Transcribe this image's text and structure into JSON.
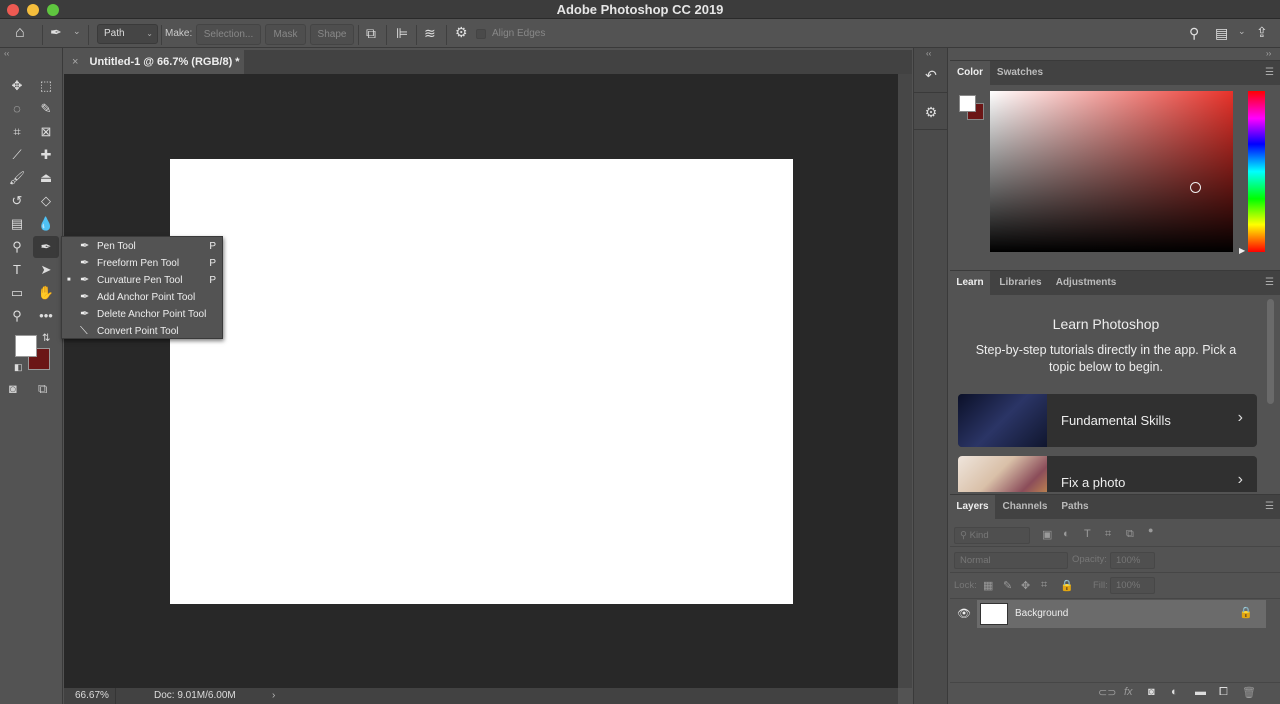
{
  "window": {
    "title": "Adobe Photoshop CC 2019"
  },
  "options_bar": {
    "mode": "Path",
    "make_label": "Make:",
    "selection_btn": "Selection...",
    "mask_btn": "Mask",
    "shape_btn": "Shape",
    "align_edges_label": "Align Edges",
    "align_edges_checked": false
  },
  "document": {
    "tab_title": "Untitled-1 @ 66.7% (RGB/8) *",
    "zoom": "66.67%",
    "doc_info": "Doc: 9.01M/6.00M"
  },
  "toolbar": {
    "tools": [
      {
        "name": "move-tool",
        "glyph": "✥"
      },
      {
        "name": "marquee-tool",
        "glyph": "⬚"
      },
      {
        "name": "lasso-tool",
        "glyph": "◌"
      },
      {
        "name": "quick-selection-tool",
        "glyph": "✎"
      },
      {
        "name": "crop-tool",
        "glyph": "⌗"
      },
      {
        "name": "frame-tool",
        "glyph": "⊠"
      },
      {
        "name": "eyedropper-tool",
        "glyph": "⟋"
      },
      {
        "name": "healing-brush-tool",
        "glyph": "✚"
      },
      {
        "name": "brush-tool",
        "glyph": "🖌"
      },
      {
        "name": "clone-stamp-tool",
        "glyph": "⏏"
      },
      {
        "name": "history-brush-tool",
        "glyph": "↺"
      },
      {
        "name": "eraser-tool",
        "glyph": "◇"
      },
      {
        "name": "gradient-tool",
        "glyph": "▤"
      },
      {
        "name": "blur-tool",
        "glyph": "💧"
      },
      {
        "name": "dodge-tool",
        "glyph": "⚲"
      },
      {
        "name": "pen-tool",
        "glyph": "✒"
      },
      {
        "name": "type-tool",
        "glyph": "T"
      },
      {
        "name": "path-selection-tool",
        "glyph": "➤"
      },
      {
        "name": "rectangle-tool",
        "glyph": "▭"
      },
      {
        "name": "hand-tool",
        "glyph": "✋"
      },
      {
        "name": "zoom-tool",
        "glyph": "⚲"
      },
      {
        "name": "more-tools",
        "glyph": "•••"
      }
    ],
    "foreground_color": "#ffffff",
    "background_color": "#6b1616"
  },
  "pen_flyout": {
    "items": [
      {
        "label": "Pen Tool",
        "shortcut": "P",
        "selected": false
      },
      {
        "label": "Freeform Pen Tool",
        "shortcut": "P",
        "selected": false
      },
      {
        "label": "Curvature Pen Tool",
        "shortcut": "P",
        "selected": true
      },
      {
        "label": "Add Anchor Point Tool",
        "shortcut": "",
        "selected": false
      },
      {
        "label": "Delete Anchor Point Tool",
        "shortcut": "",
        "selected": false
      },
      {
        "label": "Convert Point Tool",
        "shortcut": "",
        "selected": false
      }
    ]
  },
  "color_panel": {
    "tabs": [
      "Color",
      "Swatches"
    ],
    "active_tab": "Color",
    "hue_color": "#e8322a",
    "foreground": "#ffffff",
    "background": "#6b1616"
  },
  "learn_panel": {
    "tabs": [
      "Learn",
      "Libraries",
      "Adjustments"
    ],
    "active_tab": "Learn",
    "heading": "Learn Photoshop",
    "description": "Step-by-step tutorials directly in the app. Pick a topic below to begin.",
    "cards": [
      {
        "title": "Fundamental Skills"
      },
      {
        "title": "Fix a photo"
      }
    ]
  },
  "layers_panel": {
    "tabs": [
      "Layers",
      "Channels",
      "Paths"
    ],
    "active_tab": "Layers",
    "filter_kind": "Kind",
    "blend_mode": "Normal",
    "opacity_label": "Opacity:",
    "opacity": "100%",
    "lock_label": "Lock:",
    "fill_label": "Fill:",
    "fill": "100%",
    "layers": [
      {
        "name": "Background",
        "visible": true,
        "locked": true
      }
    ]
  }
}
